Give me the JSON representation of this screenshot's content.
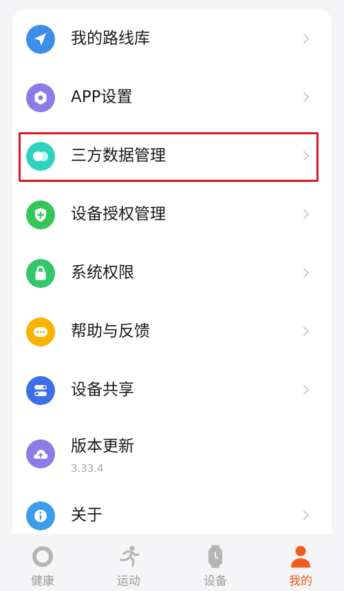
{
  "menu": {
    "items": [
      {
        "label": "我的路线库",
        "icon": "send-arrow-icon",
        "color": "#3d8ee8"
      },
      {
        "label": "APP设置",
        "icon": "hexagon-settings-icon",
        "color": "#8c7ce8"
      },
      {
        "label": "三方数据管理",
        "icon": "link-circles-icon",
        "color": "#2ed3c0"
      },
      {
        "label": "设备授权管理",
        "icon": "shield-plus-icon",
        "color": "#33c75a"
      },
      {
        "label": "系统权限",
        "icon": "lock-icon",
        "color": "#35c56a"
      },
      {
        "label": "帮助与反馈",
        "icon": "chat-bubble-icon",
        "color": "#f6b400"
      },
      {
        "label": "设备共享",
        "icon": "toggle-icon",
        "color": "#3e6ee8"
      },
      {
        "label": "版本更新",
        "sublabel": "3.33.4",
        "icon": "cloud-upload-icon",
        "color": "#8c7ce8"
      },
      {
        "label": "关于",
        "icon": "info-icon",
        "color": "#3d9ce8"
      }
    ]
  },
  "tabbar": {
    "tabs": [
      {
        "label": "健康",
        "icon": "ring-icon",
        "active": false
      },
      {
        "label": "运动",
        "icon": "running-person-icon",
        "active": false
      },
      {
        "label": "设备",
        "icon": "watch-icon",
        "active": false
      },
      {
        "label": "我的",
        "icon": "person-icon",
        "active": true
      }
    ],
    "active_color": "#f25a1f",
    "inactive_color": "#9a9a9a"
  },
  "highlight_color": "#e0141e"
}
